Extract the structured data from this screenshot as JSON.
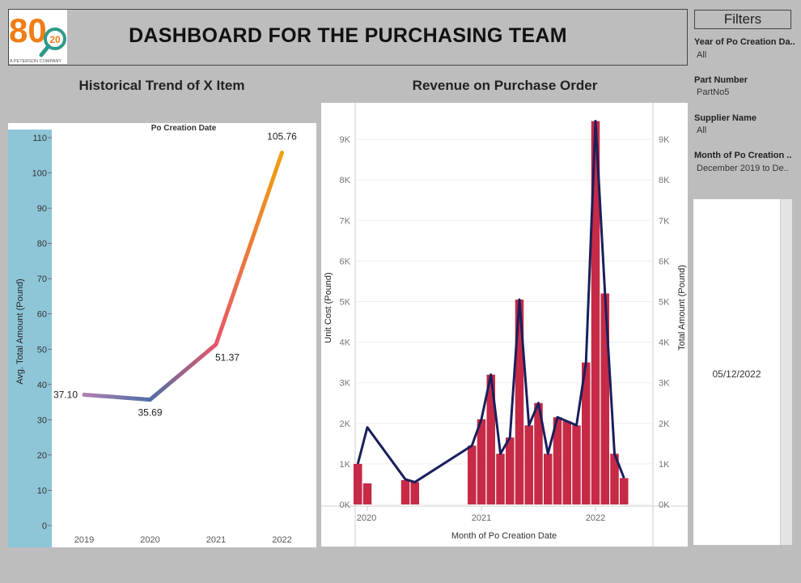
{
  "header": {
    "title": "DASHBOARD FOR THE PURCHASING TEAM"
  },
  "logo": {
    "big": "80",
    "small": "20",
    "tagline": "A PETERSON COMPANY",
    "color_primary": "#f07d14",
    "color_secondary": "#2e9a8a"
  },
  "filters": {
    "title": "Filters",
    "items": [
      {
        "label": "Year of Po Creation Da..",
        "value": "All"
      },
      {
        "label": "Part Number",
        "value": "PartNo5"
      },
      {
        "label": "Supplier Name",
        "value": "All"
      },
      {
        "label": "Month of Po Creation ..",
        "value": "December 2019 to De.."
      }
    ],
    "date_card": "05/12/2022"
  },
  "chart_data": [
    {
      "type": "line",
      "title": "Historical Trend of X Item",
      "top_axis_label": "Po Creation Date",
      "ylabel": "Avg. Total Amount (Pound)",
      "categories": [
        "2019",
        "2020",
        "2021",
        "2022"
      ],
      "values": [
        37.1,
        35.69,
        51.37,
        105.76
      ],
      "value_labels": [
        "37.10",
        "35.69",
        "51.37",
        "105.76"
      ],
      "yticks": [
        0,
        10,
        20,
        30,
        40,
        50,
        60,
        70,
        80,
        90,
        100,
        110
      ],
      "ylim": [
        0,
        110
      ],
      "gradient_colors": [
        "#b07fb0",
        "#4e6fa8",
        "#e8566a",
        "#f0a010"
      ],
      "axis_band_color": "#8ec6d8"
    },
    {
      "type": "bar",
      "title": "Revenue on Purchase Order",
      "xlabel": "Month of Po Creation Date",
      "ylabel_left": "Unit Cost (Pound)",
      "ylabel_right": "Total Amount (Pound)",
      "x_ticks": [
        "2020",
        "2021",
        "2022"
      ],
      "y_ticks": [
        "0K",
        "1K",
        "2K",
        "3K",
        "4K",
        "5K",
        "6K",
        "7K",
        "8K",
        "9K"
      ],
      "ylim": [
        0,
        9700
      ],
      "months": [
        "2019-12",
        "2020-01",
        "2020-05",
        "2020-06",
        "2020-12",
        "2021-01",
        "2021-02",
        "2021-03",
        "2021-04",
        "2021-05",
        "2021-06",
        "2021-07",
        "2021-08",
        "2021-09",
        "2021-10",
        "2021-11",
        "2021-12",
        "2022-01",
        "2022-02",
        "2022-03",
        "2022-04",
        "2022-05"
      ],
      "series": [
        {
          "type": "bar",
          "values": [
            1000,
            520,
            600,
            550,
            1450,
            2100,
            3200,
            1250,
            1650,
            5050,
            1950,
            2500,
            1250,
            2150,
            2050,
            1950,
            3500,
            9450,
            5200,
            1250,
            650,
            null
          ],
          "color": "#c62a46"
        },
        {
          "type": "line",
          "values": [
            1000,
            1900,
            620,
            550,
            1450,
            2100,
            3200,
            1250,
            1650,
            5050,
            1950,
            2500,
            1250,
            2150,
            2050,
            1950,
            3500,
            9450,
            5200,
            1250,
            650,
            null
          ],
          "color": "#1a1f5c"
        }
      ]
    }
  ]
}
